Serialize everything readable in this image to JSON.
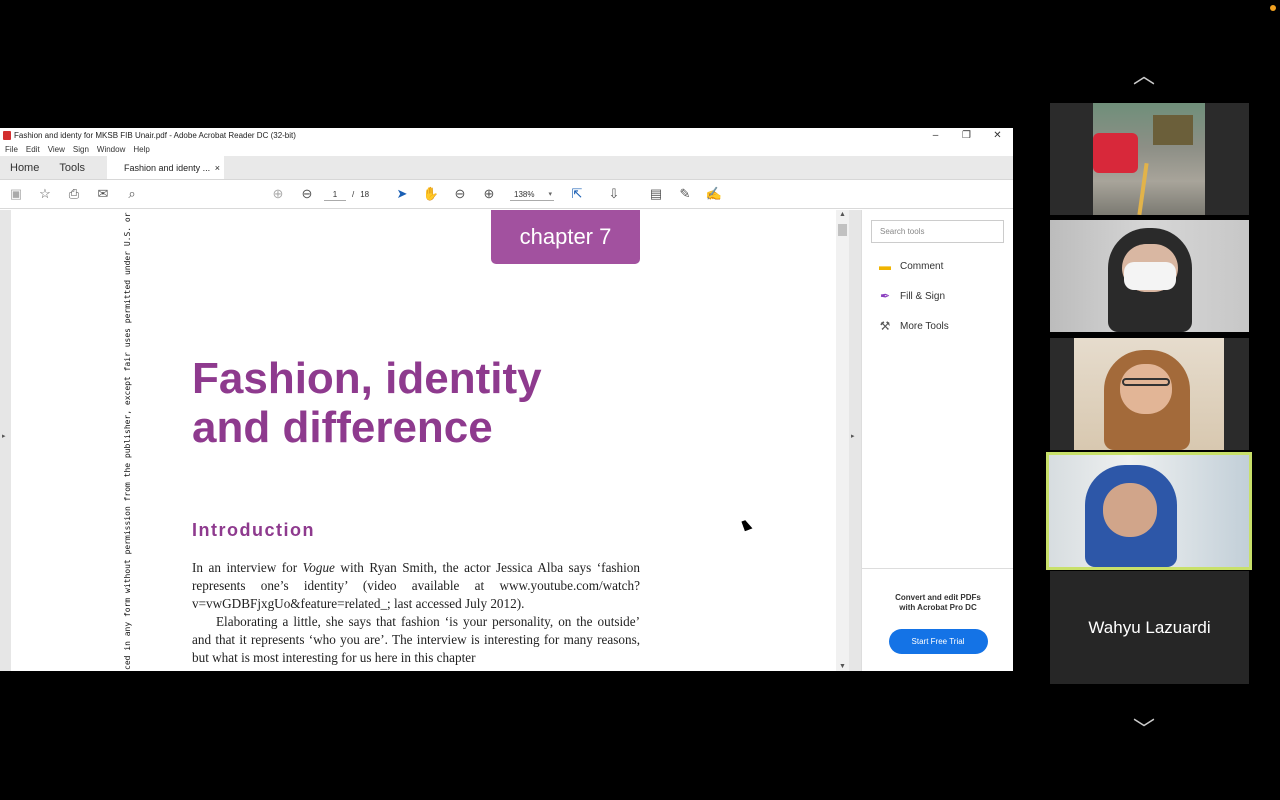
{
  "window": {
    "title": "Fashion and identy for MKSB FIB Unair.pdf - Adobe Acrobat Reader DC (32-bit)",
    "minimize": "–",
    "maximize": "❐",
    "close": "✕"
  },
  "menu": [
    "File",
    "Edit",
    "View",
    "Sign",
    "Window",
    "Help"
  ],
  "tabs": {
    "home": "Home",
    "tools": "Tools",
    "document": "Fashion and identy ...",
    "close": "×"
  },
  "toolbar": {
    "page_current": "1",
    "page_sep": "/",
    "page_total": "18",
    "zoom": "138%"
  },
  "document": {
    "chapter": "chapter 7",
    "side_text": "ced in any form without permission from the publisher, except fair uses permitted under U.S. or",
    "title_line1": "Fashion, identity",
    "title_line2": "and difference",
    "section": "Introduction",
    "para1_a": "In an interview for ",
    "para1_em": "Vogue",
    "para1_b": " with Ryan Smith, the actor Jessica Alba says ‘fashion represents one’s identity’ (video available at www.youtube.com/watch?v=vwGDBFjxgUo&feature=related_; last accessed July 2012).",
    "para2": "Elaborating a little, she says that fashion ‘is your personality, on the outside’ and that it represents ‘who you are’. The interview is interesting for many reasons, but what is most interesting for us here in this chapter"
  },
  "side_panel": {
    "search_placeholder": "Search tools",
    "tools": [
      {
        "label": "Comment",
        "icon": "comment-icon",
        "color": "#f0b400"
      },
      {
        "label": "Fill & Sign",
        "icon": "fill-sign-icon",
        "color": "#8a3dbf"
      },
      {
        "label": "More Tools",
        "icon": "more-tools-icon",
        "color": "#555555"
      }
    ],
    "promo_line1": "Convert and edit PDFs",
    "promo_line2": "with Acrobat Pro DC",
    "trial_button": "Start Free Trial"
  },
  "meeting": {
    "participant_name": "Wahyu Lazuardi",
    "active_speaker_color": "#c8e06a"
  }
}
